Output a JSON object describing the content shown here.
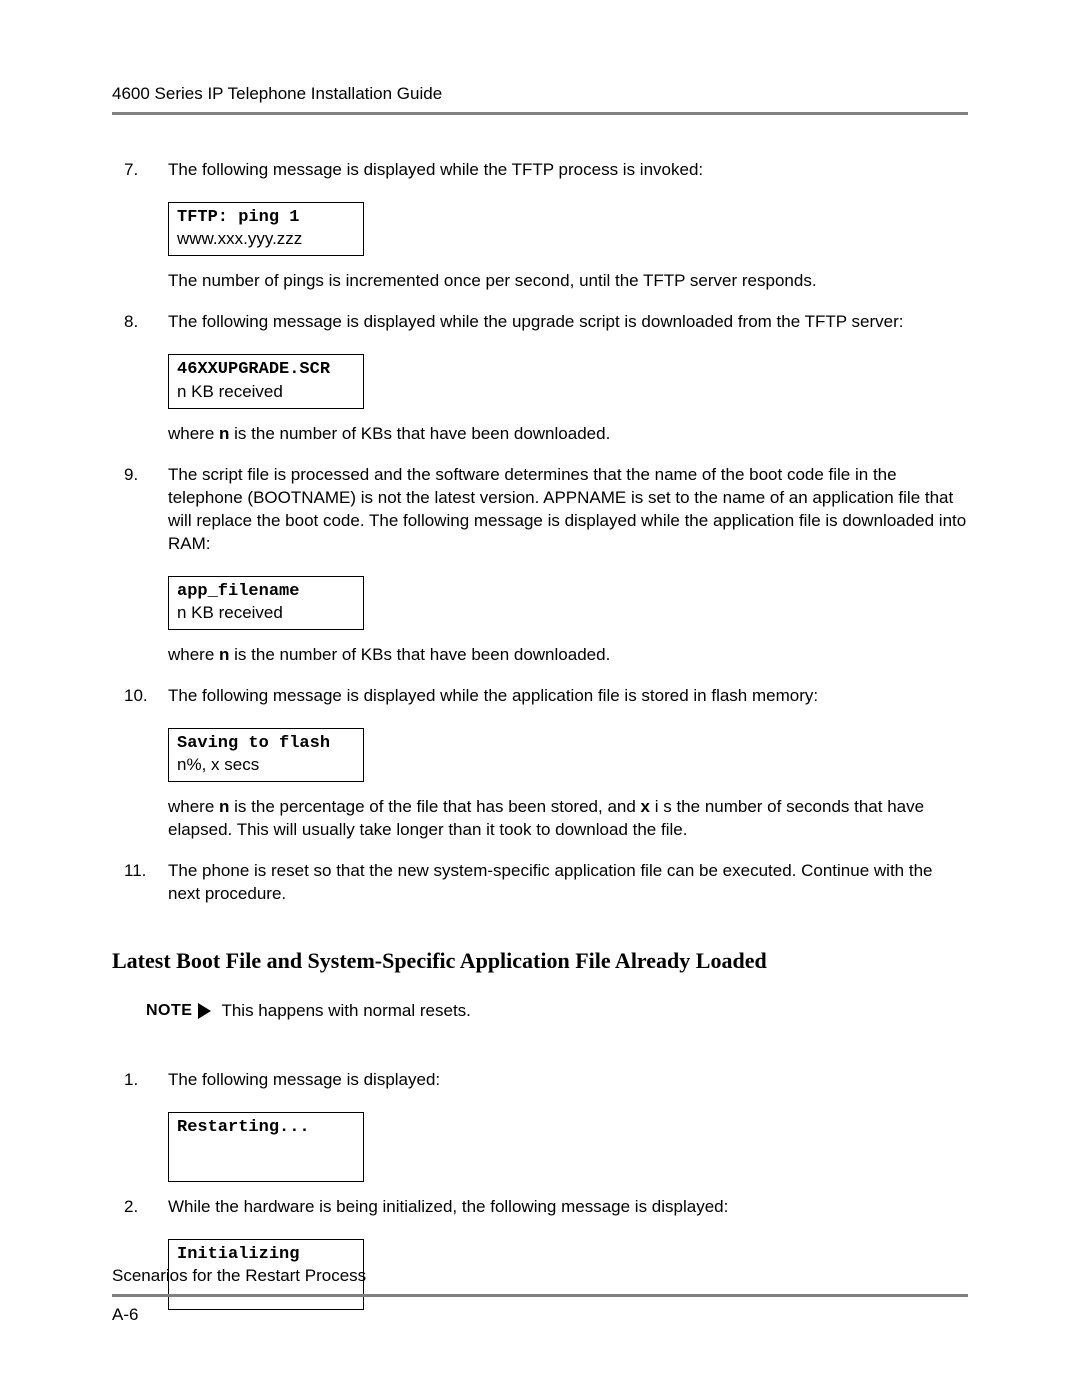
{
  "header": {
    "running_title": "4600 Series IP Telephone Installation Guide"
  },
  "steps_a": [
    {
      "num": "7.",
      "text": "The following message is displayed while the TFTP process is invoked:",
      "display": {
        "line1": "TFTP: ping 1",
        "line2": "www.xxx.yyy.zzz"
      },
      "after": "The number of pings is incremented once per second, until the TFTP server responds."
    },
    {
      "num": "8.",
      "text": "The following message is displayed while the upgrade script is downloaded from the TFTP server:",
      "display": {
        "line1": "46XXUPGRADE.SCR",
        "line2": "n KB received"
      },
      "after_pre": "where ",
      "after_bold": "n",
      "after_post": " is the number of KBs that have been downloaded."
    },
    {
      "num": "9.",
      "text": "The script file is processed and the software determines that the name of the boot code file in the telephone (BOOTNAME) is not the latest version. APPNAME is set to the name of an application file that will replace the boot code. The following message is displayed while the application file is downloaded into RAM:",
      "display": {
        "line1": "app_filename",
        "line2": "n KB received"
      },
      "after_pre": "where ",
      "after_bold": "n",
      "after_post": " is the number of KBs that have been downloaded."
    },
    {
      "num": "10.",
      "text": "The following message is displayed while the application file is stored in flash memory:",
      "display": {
        "line1": "Saving to flash",
        "line2": "n%, x secs"
      },
      "after_pre": "where ",
      "after_bold": "n",
      "after_mid": " is the percentage of the file that has been stored, and ",
      "after_bold2": "x",
      "after_post": " i s the number of seconds that have elapsed. This will usually take longer than it took to download the file."
    },
    {
      "num": "11.",
      "text": "The phone is reset so that the new system-specific application file can be executed. Continue with the next procedure."
    }
  ],
  "section_heading": "Latest Boot File and System-Specific Application File Already Loaded",
  "note": {
    "word": "NOTE",
    "text": "This happens with normal resets."
  },
  "steps_b": [
    {
      "num": "1.",
      "text": "The following message is displayed:",
      "display": {
        "line1": "Restarting...",
        "line2": " "
      }
    },
    {
      "num": "2.",
      "text": "While the hardware is being initialized, the following message is displayed:",
      "display": {
        "line1": "Initializing",
        "line2": " "
      }
    }
  ],
  "footer": {
    "title": "Scenarios for the Restart Process",
    "page_num": "A-6"
  }
}
